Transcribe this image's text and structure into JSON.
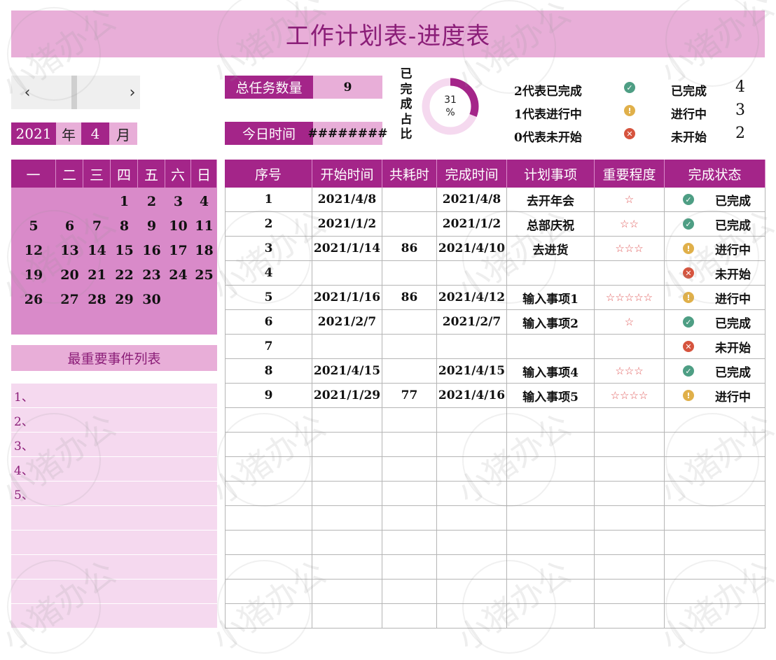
{
  "title": "工作计划表-进度表",
  "calendar_nav": {
    "prev_icon": "‹",
    "next_icon": "›"
  },
  "year": "2021",
  "year_unit": "年",
  "month": "4",
  "month_unit": "月",
  "weekdays": [
    "一",
    "二",
    "三",
    "四",
    "五",
    "六",
    "日"
  ],
  "calendar_weeks": [
    [
      "",
      "",
      "",
      "1",
      "2",
      "3",
      "4"
    ],
    [
      "5",
      "6",
      "7",
      "8",
      "9",
      "10",
      "11"
    ],
    [
      "12",
      "13",
      "14",
      "15",
      "16",
      "17",
      "18"
    ],
    [
      "19",
      "20",
      "21",
      "22",
      "23",
      "24",
      "25"
    ],
    [
      "26",
      "27",
      "28",
      "29",
      "30",
      "",
      ""
    ]
  ],
  "events": {
    "heading": "最重要事件列表",
    "items": [
      "1、",
      "2、",
      "3、",
      "4、",
      "5、",
      "",
      "",
      "",
      "",
      ""
    ]
  },
  "stats": {
    "total_label": "总任务数量",
    "total_value": "9",
    "today_label": "今日时间",
    "today_value": "########",
    "ratio_label": "已完成占比",
    "ratio_value": "31",
    "ratio_unit": "%",
    "ratio_fraction": 0.31
  },
  "legend": [
    {
      "desc": "2代表已完成",
      "status": "已完成",
      "count": "4",
      "icon": "check-icon",
      "color": "#4e9e84"
    },
    {
      "desc": "1代表进行中",
      "status": "进行中",
      "count": "3",
      "icon": "exclamation-icon",
      "color": "#e0b04a"
    },
    {
      "desc": "0代表未开始",
      "status": "未开始",
      "count": "2",
      "icon": "cross-icon",
      "color": "#d6543e"
    }
  ],
  "table": {
    "headers": [
      "序号",
      "开始时间",
      "共耗时",
      "完成时间",
      "计划事项",
      "重要程度",
      "完成状态"
    ],
    "rows": [
      {
        "no": "1",
        "start": "2021/4/8",
        "duration": "",
        "end": "2021/4/8",
        "item": "去开年会",
        "stars": "☆",
        "status": "已完成",
        "code": 2
      },
      {
        "no": "2",
        "start": "2021/1/2",
        "duration": "",
        "end": "2021/1/2",
        "item": "总部庆祝",
        "stars": "☆☆",
        "status": "已完成",
        "code": 2
      },
      {
        "no": "3",
        "start": "2021/1/14",
        "duration": "86",
        "end": "2021/4/10",
        "item": "去进货",
        "stars": "☆☆☆",
        "status": "进行中",
        "code": 1
      },
      {
        "no": "4",
        "start": "",
        "duration": "",
        "end": "",
        "item": "",
        "stars": "",
        "status": "未开始",
        "code": 0
      },
      {
        "no": "5",
        "start": "2021/1/16",
        "duration": "86",
        "end": "2021/4/12",
        "item": "输入事项1",
        "stars": "☆☆☆☆☆",
        "status": "进行中",
        "code": 1
      },
      {
        "no": "6",
        "start": "2021/2/7",
        "duration": "",
        "end": "2021/2/7",
        "item": "输入事项2",
        "stars": "☆",
        "status": "已完成",
        "code": 2
      },
      {
        "no": "7",
        "start": "",
        "duration": "",
        "end": "",
        "item": "",
        "stars": "",
        "status": "未开始",
        "code": 0
      },
      {
        "no": "8",
        "start": "2021/4/15",
        "duration": "",
        "end": "2021/4/15",
        "item": "输入事项4",
        "stars": "☆☆☆",
        "status": "已完成",
        "code": 2
      },
      {
        "no": "9",
        "start": "2021/1/29",
        "duration": "77",
        "end": "2021/4/16",
        "item": "输入事项5",
        "stars": "☆☆☆☆",
        "status": "进行中",
        "code": 1
      }
    ],
    "empty_rows": 9
  },
  "watermark": "小猪办公",
  "colors": {
    "accent_dark": "#a42589",
    "accent_light": "#e8aed8",
    "accent_mid": "#d98ac9",
    "event_bg": "#f5d9ef"
  }
}
